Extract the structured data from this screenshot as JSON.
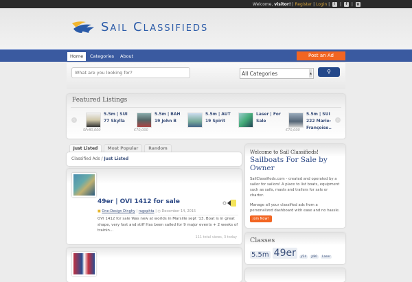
{
  "topbar": {
    "welcome": "Welcome,",
    "user": "visitor!",
    "sep": "|",
    "register": "Register",
    "login": "Login",
    "icons": [
      "rss-icon",
      "facebook-icon",
      "google-plus-icon"
    ]
  },
  "header": {
    "logo_text": "Sail Classifieds"
  },
  "nav": {
    "items": [
      "Home",
      "Categories",
      "About"
    ],
    "post_ad": "Post an Ad"
  },
  "search": {
    "placeholder": "What are you looking for?",
    "category": "All Categories",
    "button_icon": "search-icon"
  },
  "featured": {
    "title": "Featured Listings",
    "items": [
      {
        "title": "5.5m | SUI 77 Skylla",
        "price": "SFr80,000"
      },
      {
        "title": "5.5m | BAH 19 John B",
        "price": "€70,000"
      },
      {
        "title": "5.5m | AUT 19 Spirit",
        "price": ""
      },
      {
        "title": "Laser | For Sale",
        "price": ""
      },
      {
        "title": "5.5m | SUI 222 Marie-Françoise..",
        "price": "€70,000"
      }
    ]
  },
  "tabs": [
    "Just Listed",
    "Most Popular",
    "Random"
  ],
  "breadcrumb": {
    "root": "Classified Ads",
    "sep": "/",
    "current": "Just Listed"
  },
  "listing": {
    "title": "49er | OVI 1412 for sale",
    "category": "One-Design Dinghy",
    "author": "rugophta",
    "sep": "|",
    "date": "December 14, 2015",
    "description": "OVI 1412 for sale Was new at worlds in Marsille sept '13. Boat is in great shape, very fast and stiff Has been sailed for 9 major events + 2 weeks of trainin...",
    "views": "111 total views, 3 today"
  },
  "welcome": {
    "heading": "Welcome to Sail Classifieds!",
    "subheading": "Sailboats For Sale by Owner",
    "p1": "SailClassifieds.com - created and operated by a sailor for sailors! A place to list boats, equipment such as sails, masts and trailers for sale or charter.",
    "p2": "Manage all your classified ads from a personalized dashboard with ease and no hassle.",
    "join": "Join Now!"
  },
  "classes": {
    "title": "Classes",
    "tags": [
      "5.5m",
      "49er",
      "J/24",
      "J/80",
      "Laser"
    ]
  },
  "colors": {
    "nav": "#3a5aa0",
    "accent": "#f26522",
    "link": "#2e4a86"
  }
}
